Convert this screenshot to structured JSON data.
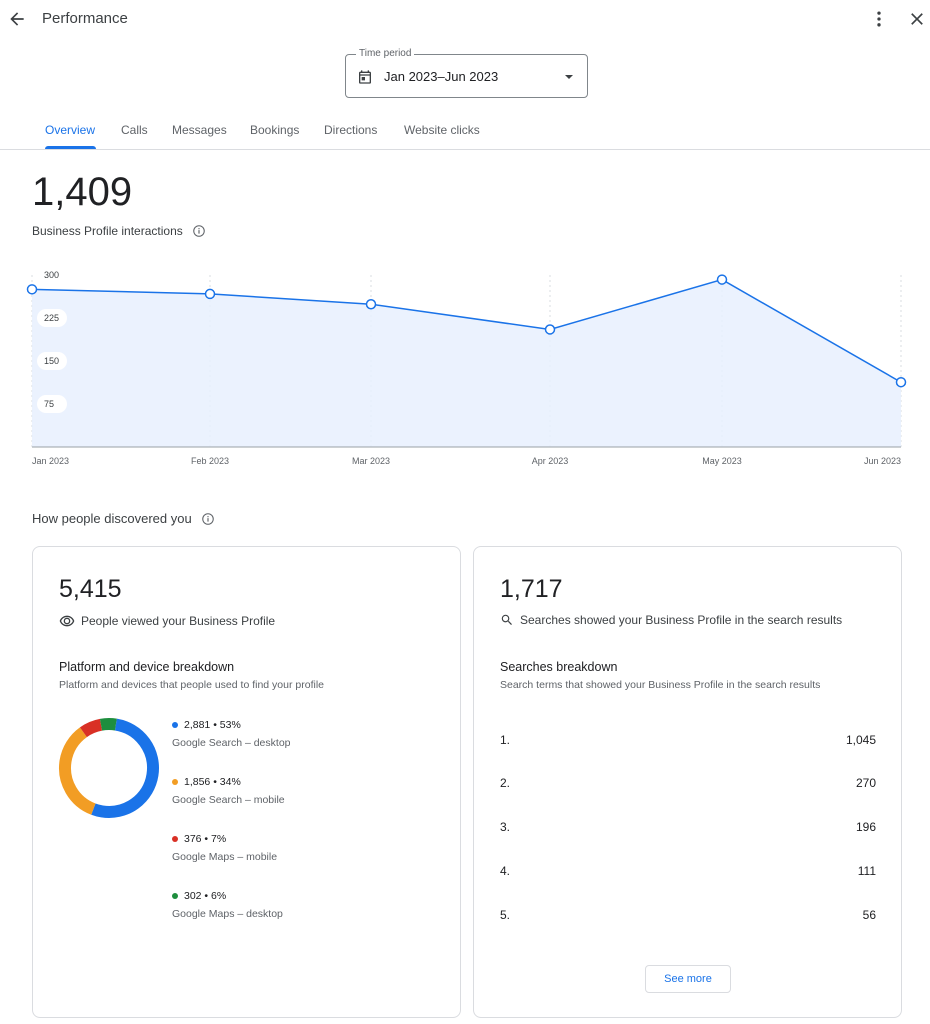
{
  "header": {
    "title": "Performance",
    "back_icon": "arrow-back-icon",
    "more_icon": "more-vert-icon",
    "close_icon": "close-icon"
  },
  "time_period": {
    "label": "Time period",
    "value": "Jan 2023–Jun 2023",
    "icon": "calendar-icon"
  },
  "tabs": [
    {
      "label": "Overview",
      "active": true
    },
    {
      "label": "Calls"
    },
    {
      "label": "Messages"
    },
    {
      "label": "Bookings"
    },
    {
      "label": "Directions"
    },
    {
      "label": "Website clicks"
    }
  ],
  "summary": {
    "total": "1,409",
    "label": "Business Profile interactions"
  },
  "chart_data": {
    "type": "area",
    "x": [
      "Jan 2023",
      "Feb 2023",
      "Mar 2023",
      "Apr 2023",
      "May 2023",
      "Jun 2023"
    ],
    "values": [
      275,
      267,
      249,
      205,
      292,
      113
    ],
    "yticks": [
      300,
      225,
      150,
      75
    ],
    "ylim": [
      0,
      300
    ],
    "grid": "vertical-dashed",
    "colors": {
      "line": "#1a73e8",
      "fill": "#e8f0fe"
    }
  },
  "discovery": {
    "title": "How people discovered you"
  },
  "views_card": {
    "total": "5,415",
    "subtitle": "People viewed your Business Profile",
    "icon": "eye-icon",
    "breakdown_title": "Platform and device breakdown",
    "breakdown_subtitle": "Platform and devices that people used to find your profile",
    "items": [
      {
        "value": "2,881 • 53%",
        "name": "Google Search – desktop",
        "count": 2881,
        "color": "#1a73e8"
      },
      {
        "value": "1,856 • 34%",
        "name": "Google Search – mobile",
        "count": 1856,
        "color": "#f29d24"
      },
      {
        "value": "376 • 7%",
        "name": "Google Maps – mobile",
        "count": 376,
        "color": "#d93025"
      },
      {
        "value": "302 • 6%",
        "name": "Google Maps – desktop",
        "count": 302,
        "color": "#1e8e3e"
      }
    ]
  },
  "searches_card": {
    "total": "1,717",
    "subtitle": "Searches showed your Business Profile in the search results",
    "icon": "search-icon",
    "breakdown_title": "Searches breakdown",
    "breakdown_subtitle": "Search terms that showed your Business Profile in the search results",
    "rows": [
      {
        "rank": "1.",
        "count": "1,045"
      },
      {
        "rank": "2.",
        "count": "270"
      },
      {
        "rank": "3.",
        "count": "196"
      },
      {
        "rank": "4.",
        "count": "111"
      },
      {
        "rank": "5.",
        "count": "56"
      }
    ],
    "see_more": "See more"
  }
}
